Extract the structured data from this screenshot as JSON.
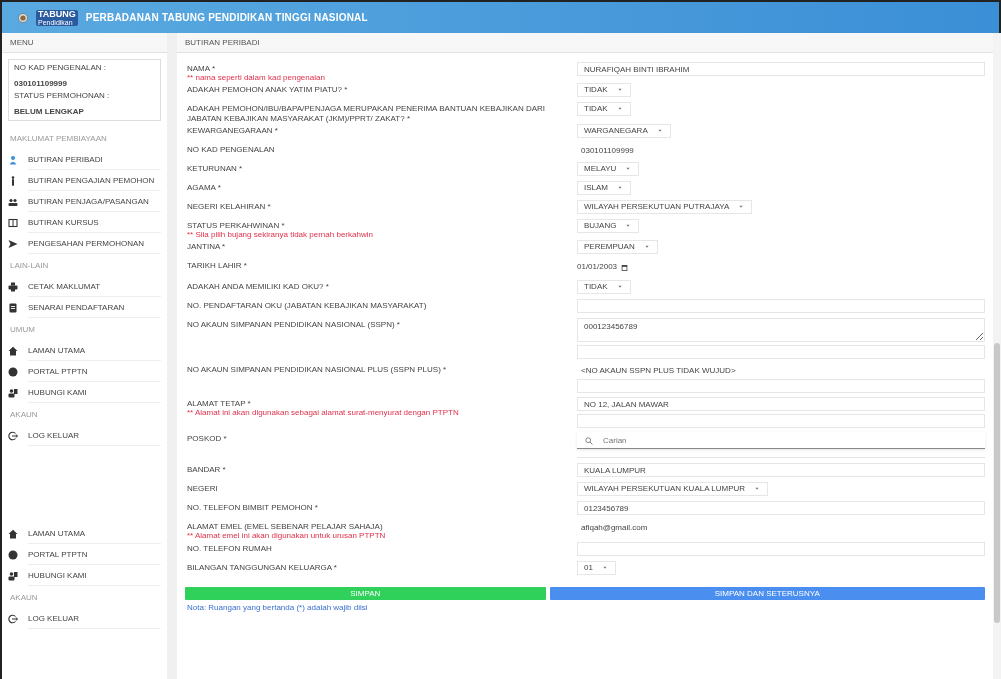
{
  "header": {
    "logo_text": "TABUNG",
    "logo_subtext": "Pendidikan",
    "title": "PERBADANAN TABUNG PENDIDIKAN TINGGI NASIONAL"
  },
  "sidebar": {
    "title": "MENU",
    "info": [
      {
        "label": "NO KAD PENGENALAN :",
        "value": "030101109999"
      },
      {
        "label": "STATUS PERMOHONAN :",
        "value": "BELUM LENGKAP"
      }
    ],
    "sections": [
      {
        "heading": "MAKLUMAT PEMBIAYAAN",
        "items": [
          {
            "label": "BUTIRAN PERIBADI",
            "selected": true
          },
          {
            "label": "BUTIRAN PENGAJIAN PEMOHON",
            "selected": false
          },
          {
            "label": "BUTIRAN PENJAGA/PASANGAN",
            "selected": false
          },
          {
            "label": "BUTIRAN KURSUS",
            "selected": false
          },
          {
            "label": "PENGESAHAN PERMOHONAN",
            "selected": false
          }
        ]
      },
      {
        "heading": "LAIN-LAIN",
        "items": [
          {
            "label": "CETAK MAKLUMAT",
            "selected": false
          },
          {
            "label": "SENARAI PENDAFTARAN",
            "selected": false
          }
        ]
      },
      {
        "heading": "UMUM",
        "items": [
          {
            "label": "LAMAN UTAMA",
            "selected": false
          },
          {
            "label": "PORTAL PTPTN",
            "selected": false
          },
          {
            "label": "HUBUNGI KAMI",
            "selected": false
          }
        ]
      },
      {
        "heading": "AKAUN",
        "items": [
          {
            "label": "LOG KELUAR",
            "selected": false
          }
        ]
      }
    ],
    "footer_sections": [
      {
        "items": [
          {
            "label": "LAMAN UTAMA",
            "selected": false
          },
          {
            "label": "PORTAL PTPTN",
            "selected": false
          },
          {
            "label": "HUBUNGI KAMI",
            "selected": false
          }
        ]
      },
      {
        "heading": "AKAUN",
        "items": [
          {
            "label": "LOG KELUAR",
            "selected": false
          }
        ]
      }
    ]
  },
  "main": {
    "title": "BUTIRAN PERIBADI",
    "fields": [
      {
        "label": "NAMA *",
        "hint": "** nama seperti dalam kad pengenalan",
        "controls": [
          {
            "kind": "input",
            "value": "NURAFIQAH BINTI IBRAHIM"
          }
        ]
      },
      {
        "label": "ADAKAH PEMOHON ANAK YATIM PIATU? *",
        "controls": [
          {
            "kind": "select",
            "value": "TIDAK"
          }
        ]
      },
      {
        "label": "ADAKAH PEMOHON/IBU/BAPA/PENJAGA MERUPAKAN PENERIMA BANTUAN KEBAJIKAN DARI JABATAN KEBAJIKAN MASYARAKAT (JKM)/PPRT/ ZAKAT? *",
        "controls": [
          {
            "kind": "select",
            "value": "TIDAK"
          }
        ]
      },
      {
        "label": "KEWARGANEGARAAN *",
        "controls": [
          {
            "kind": "select",
            "value": "WARGANEGARA"
          }
        ]
      },
      {
        "label": "NO KAD PENGENALAN",
        "controls": [
          {
            "kind": "text",
            "value": "030101109999"
          }
        ]
      },
      {
        "label": "KETURUNAN *",
        "controls": [
          {
            "kind": "select",
            "value": "MELAYU"
          }
        ]
      },
      {
        "label": "AGAMA *",
        "controls": [
          {
            "kind": "select",
            "value": "ISLAM"
          }
        ]
      },
      {
        "label": "NEGERI KELAHIRAN *",
        "controls": [
          {
            "kind": "select",
            "value": "WILAYAH PERSEKUTUAN PUTRAJAYA"
          }
        ]
      },
      {
        "label": "STATUS PERKAHWINAN *",
        "hint": "** Sila pilih bujang sekiranya tidak pernah berkahwin",
        "controls": [
          {
            "kind": "select",
            "value": "BUJANG"
          }
        ]
      },
      {
        "label": "JANTINA *",
        "controls": [
          {
            "kind": "select",
            "value": "PEREMPUAN"
          }
        ]
      },
      {
        "label": "TARIKH LAHIR *",
        "controls": [
          {
            "kind": "date",
            "value": "01/01/2003"
          }
        ]
      },
      {
        "label": "ADAKAH ANDA MEMILIKI KAD OKU? *",
        "controls": [
          {
            "kind": "select",
            "value": "TIDAK"
          }
        ]
      },
      {
        "label": "NO. PENDAFTARAN OKU (JABATAN KEBAJIKAN MASYARAKAT)",
        "controls": [
          {
            "kind": "input"
          }
        ]
      },
      {
        "label": "NO AKAUN SIMPANAN PENDIDIKAN NASIONAL (SSPN) *",
        "controls": [
          {
            "kind": "textarea",
            "value": "000123456789"
          },
          {
            "kind": "input"
          }
        ]
      },
      {
        "label": "NO AKAUN SIMPANAN PENDIDIKAN NASIONAL PLUS (SSPN PLUS) *",
        "controls": [
          {
            "kind": "text",
            "value": "<NO AKAUN SSPN PLUS TIDAK WUJUD>"
          },
          {
            "kind": "input"
          }
        ]
      },
      {
        "label": "ALAMAT TETAP *",
        "hint": "** Alamat ini akan digunakan sebagai alamat surat-menyurat dengan PTPTN",
        "controls": [
          {
            "kind": "input",
            "value": "NO 12, JALAN MAWAR"
          },
          {
            "kind": "input"
          }
        ]
      },
      {
        "label": "POSKOD *",
        "controls": [
          {
            "kind": "search",
            "placeholder": "Carian"
          },
          {
            "kind": "line"
          }
        ]
      },
      {
        "label": "BANDAR *",
        "controls": [
          {
            "kind": "input",
            "value": "KUALA LUMPUR"
          }
        ]
      },
      {
        "label": "NEGERI",
        "controls": [
          {
            "kind": "select",
            "value": "WILAYAH PERSEKUTUAN KUALA LUMPUR"
          }
        ]
      },
      {
        "label": "NO. TELEFON BIMBIT PEMOHON *",
        "controls": [
          {
            "kind": "input",
            "value": "0123456789"
          }
        ]
      },
      {
        "label": "ALAMAT EMEL (EMEL SEBENAR PELAJAR SAHAJA)",
        "hint": "** Alamat emel ini akan digunakan untuk urusan PTPTN",
        "controls": [
          {
            "kind": "text",
            "value": "afiqah@gmail.com"
          }
        ]
      },
      {
        "label": "NO. TELEFON RUMAH",
        "controls": [
          {
            "kind": "input"
          }
        ]
      },
      {
        "label": "BILANGAN TANGGUNGAN KELUARGA *",
        "controls": [
          {
            "kind": "select",
            "value": "01"
          }
        ]
      }
    ],
    "buttons": [
      {
        "label": "SIMPAN",
        "kind": "success"
      },
      {
        "label": "SIMPAN DAN SETERUSNYA",
        "kind": "primary"
      }
    ],
    "note": "Nota: Ruangan yang bertanda (*) adalah wajib diisi"
  }
}
